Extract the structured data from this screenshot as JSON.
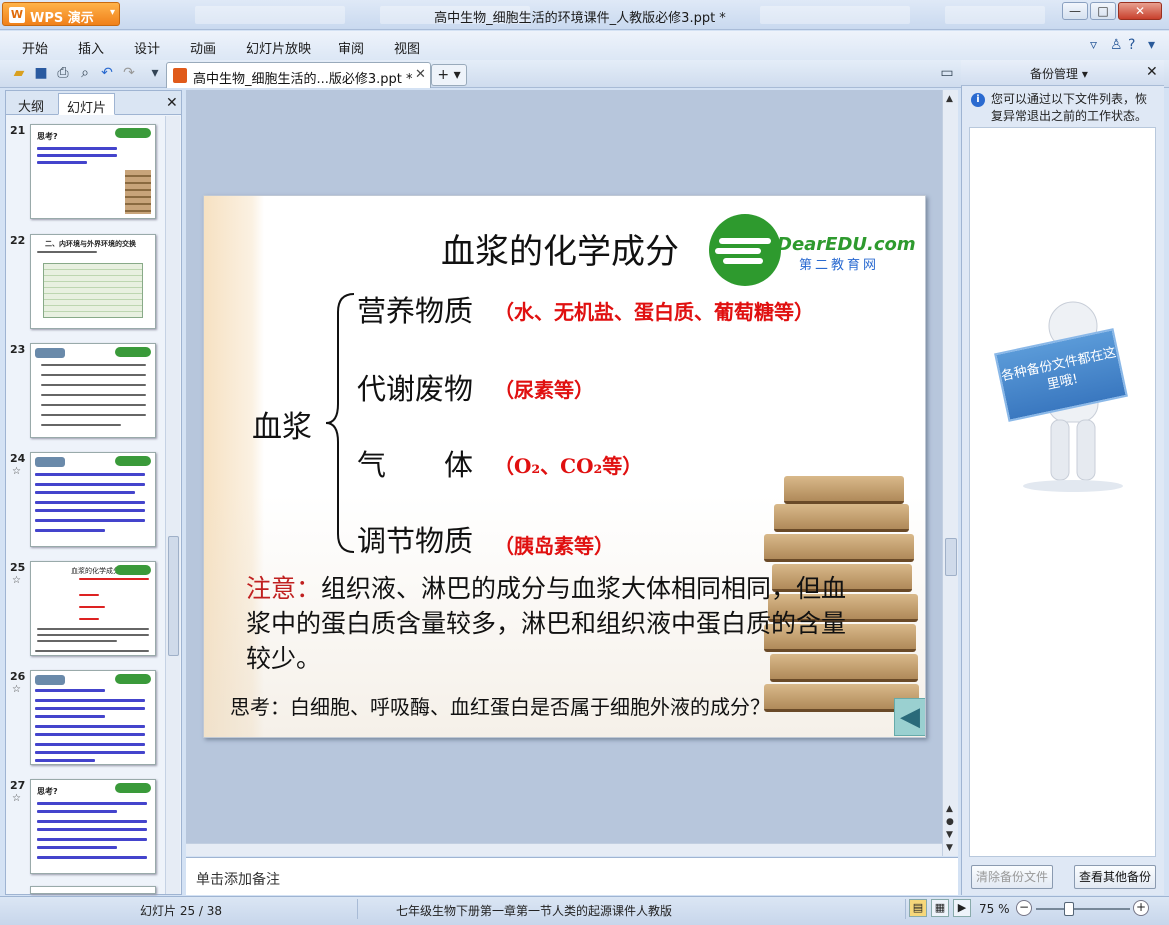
{
  "app": {
    "name": "WPS 演示",
    "window_title": "高中生物_细胞生活的环境课件_人教版必修3.ppt *"
  },
  "menu": [
    "开始",
    "插入",
    "设计",
    "动画",
    "幻灯片放映",
    "审阅",
    "视图"
  ],
  "doc_tab": {
    "label": "高中生物_细胞生活的...版必修3.ppt *"
  },
  "left_panel": {
    "tabs": [
      "大纲",
      "幻灯片"
    ],
    "thumbnails": [
      {
        "num": "21",
        "star": "",
        "title": "思考?"
      },
      {
        "num": "22",
        "star": "",
        "title": "二、内环境与外界环境的交换"
      },
      {
        "num": "23",
        "star": "",
        "title": ""
      },
      {
        "num": "24",
        "star": "☆",
        "title": ""
      },
      {
        "num": "25",
        "star": "☆",
        "title": "血浆的化学成分"
      },
      {
        "num": "26",
        "star": "☆",
        "title": ""
      },
      {
        "num": "27",
        "star": "☆",
        "title": "思考?"
      }
    ]
  },
  "slide": {
    "title": "血浆的化学成分",
    "logo_en": "DearEDU.com",
    "logo_cn": "第二教育网",
    "root": "血浆",
    "categories": [
      {
        "name": "营养物质",
        "note": "（水、无机盐、蛋白质、葡萄糖等）"
      },
      {
        "name": "代谢废物",
        "note": "（尿素等）"
      },
      {
        "name": "气　　体",
        "note": "（O₂、CO₂等）"
      },
      {
        "name": "调节物质",
        "note": "（胰岛素等）"
      }
    ],
    "attention_label": "注意：",
    "attention_text": "组织液、淋巴的成分与血浆大体相同相同，但血浆中的蛋白质含量较多，淋巴和组织液中蛋白质的含量较少。",
    "think": "思考：白细胞、呼吸酶、血红蛋白是否属于细胞外液的成分？"
  },
  "notes_placeholder": "单击添加备注",
  "right_panel": {
    "title": "备份管理",
    "info": "您可以通过以下文件列表，恢复异常退出之前的工作状态。",
    "sign_text": "各种备份文件都在这里哦!",
    "clear_button": "清除备份文件",
    "other_button": "查看其他备份"
  },
  "status": {
    "slide_info": "幻灯片 25 / 38",
    "doc_name": "七年级生物下册第一章第一节人类的起源课件人教版",
    "zoom": "75 %"
  }
}
